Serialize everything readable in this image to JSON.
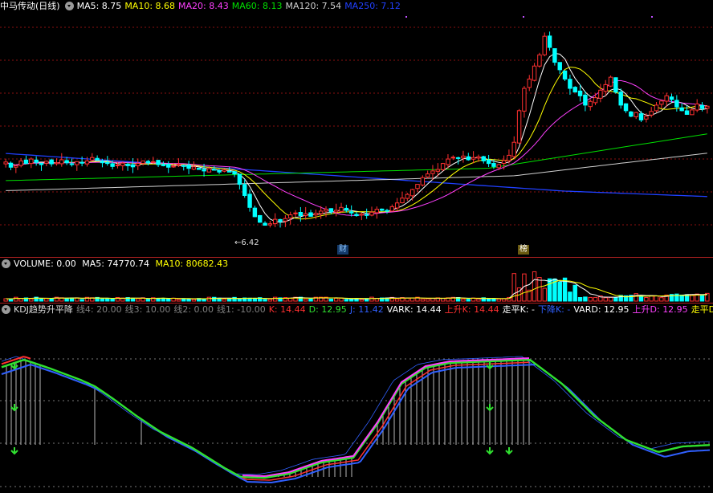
{
  "main": {
    "stock_name": "中马传动",
    "period": "(日线)",
    "ma_labels": [
      {
        "text": "MA5: 8.75",
        "color": "#ffffff"
      },
      {
        "text": "MA10: 8.68",
        "color": "#ffff00"
      },
      {
        "text": "MA20: 8.43",
        "color": "#ff40ff"
      },
      {
        "text": "MA60: 8.13",
        "color": "#00e000"
      },
      {
        "text": "MA120: 7.54",
        "color": "#d0d0d0"
      },
      {
        "text": "MA250: 7.12",
        "color": "#2040ff"
      }
    ],
    "low_label": "6.42",
    "marker_cai": "财",
    "marker_bang": "榜"
  },
  "volume": {
    "title": "VOLUME: 0.00",
    "ma5": "MA5: 74770.74",
    "ma10": "MA10: 80682.43"
  },
  "kdj": {
    "labels": [
      {
        "text": "KDJ趋势升平降",
        "color": "#dddddd"
      },
      {
        "text": "线4: 20.00",
        "color": "#808080"
      },
      {
        "text": "线3: 10.00",
        "color": "#808080"
      },
      {
        "text": "线2: 0.00",
        "color": "#808080"
      },
      {
        "text": "线1: -10.00",
        "color": "#808080"
      },
      {
        "text": "K: 14.44",
        "color": "#ff3030"
      },
      {
        "text": "D: 12.95",
        "color": "#30e030"
      },
      {
        "text": "J: 11.42",
        "color": "#3060ff"
      },
      {
        "text": "VARK: 14.44",
        "color": "#ffffff"
      },
      {
        "text": "上升K: 14.44",
        "color": "#ff3030"
      },
      {
        "text": "走平K: -",
        "color": "#ffffff"
      },
      {
        "text": "下降K: -",
        "color": "#3060ff"
      },
      {
        "text": "VARD: 12.95",
        "color": "#ffffff"
      },
      {
        "text": "上升D: 12.95",
        "color": "#ff40ff"
      },
      {
        "text": "走平D: -",
        "color": "#ffff00"
      }
    ]
  },
  "colors": {
    "up": "#ff3030",
    "down": "#00ffff",
    "grid": "#8a1010",
    "separator": "#b02020"
  },
  "price_series": [
    8.32,
    8.18,
    8.22,
    8.35,
    8.28,
    8.4,
    8.31,
    8.25,
    8.34,
    8.27,
    8.3,
    8.38,
    8.3,
    8.26,
    8.33,
    8.29,
    8.35,
    8.44,
    8.37,
    8.3,
    8.28,
    8.2,
    8.24,
    8.29,
    8.22,
    8.19,
    8.28,
    8.35,
    8.3,
    8.33,
    8.25,
    8.22,
    8.18,
    8.21,
    8.26,
    8.22,
    8.15,
    8.19,
    8.12,
    8.08,
    8.14,
    8.1,
    8.05,
    8.11,
    8.07,
    8.0,
    7.72,
    7.42,
    7.1,
    6.85,
    6.7,
    6.62,
    6.66,
    6.78,
    6.72,
    6.8,
    6.9,
    6.95,
    6.88,
    6.93,
    6.86,
    6.94,
    7.0,
    7.05,
    6.98,
    7.02,
    7.1,
    7.02,
    6.95,
    6.88,
    6.92,
    6.9,
    6.97,
    7.05,
    7.02,
    7.0,
    7.12,
    7.22,
    7.35,
    7.45,
    7.58,
    7.72,
    7.9,
    8.0,
    8.08,
    8.12,
    8.28,
    8.4,
    8.45,
    8.42,
    8.48,
    8.38,
    8.44,
    8.46,
    8.35,
    8.28,
    8.2,
    8.25,
    8.36,
    8.5,
    8.85,
    9.7,
    10.3,
    10.55,
    10.9,
    11.2,
    11.7,
    11.4,
    11.0,
    10.8,
    10.55,
    10.3,
    10.2,
    10.1,
    9.85,
    9.95,
    10.05,
    10.25,
    10.4,
    10.6,
    10.2,
    9.85,
    9.7,
    9.55,
    9.65,
    9.45,
    9.55,
    9.68,
    9.85,
    9.96,
    10.1,
    10.0,
    9.8,
    9.7,
    9.6,
    9.72,
    9.88,
    9.76,
    9.82
  ]
}
